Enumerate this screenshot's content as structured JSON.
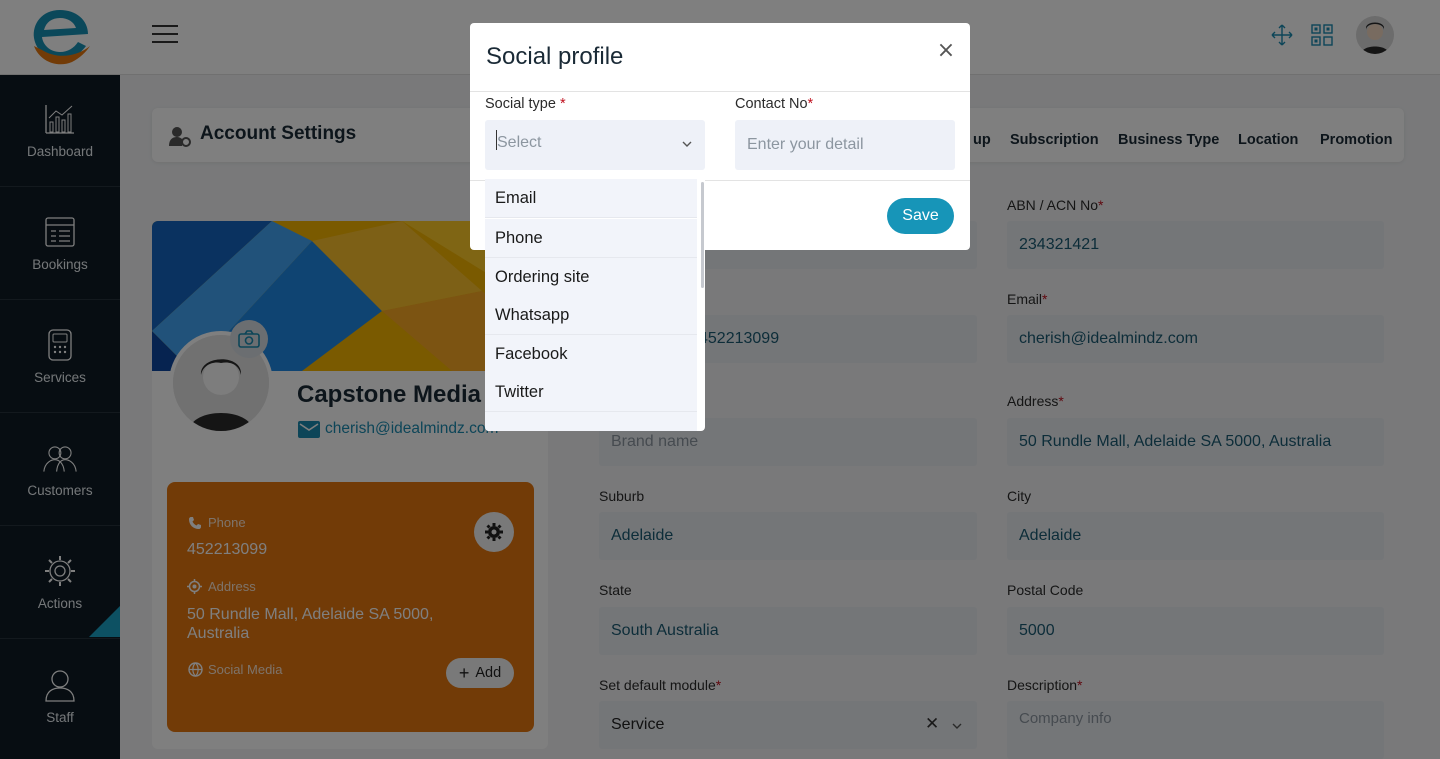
{
  "sidebar": {
    "items": [
      {
        "label": "Dashboard",
        "icon": "chart-icon"
      },
      {
        "label": "Bookings",
        "icon": "list-icon"
      },
      {
        "label": "Services",
        "icon": "calculator-icon"
      },
      {
        "label": "Customers",
        "icon": "users-icon"
      },
      {
        "label": "Actions",
        "icon": "gear-icon"
      },
      {
        "label": "Staff",
        "icon": "user-icon"
      }
    ]
  },
  "header": {
    "title": "Account Settings",
    "tabs": [
      "up",
      "Subscription",
      "Business Type",
      "Location",
      "Promotion"
    ]
  },
  "profile": {
    "company_name": "Capstone Media",
    "email": "cherish@idealmindz.com",
    "phone_label": "Phone",
    "phone": "452213099",
    "address_label": "Address",
    "address": "50 Rundle Mall, Adelaide SA 5000, Australia",
    "social_label": "Social Media",
    "add_label": "Add"
  },
  "form": {
    "abn_label": "ABN / ACN No",
    "abn_value": "234321421",
    "email_label": "Email",
    "email_value": "cherish@idealmindz.com",
    "phone_partial": "452213099",
    "brand_placeholder": "Brand name",
    "address_label": "Address",
    "address_value": "50 Rundle Mall, Adelaide SA 5000, Australia",
    "suburb_label": "Suburb",
    "suburb_value": "Adelaide",
    "city_label": "City",
    "city_value": "Adelaide",
    "state_label": "State",
    "state_value": "South Australia",
    "postal_label": "Postal Code",
    "postal_value": "5000",
    "module_label": "Set default module",
    "module_value": "Service",
    "description_label": "Description",
    "description_placeholder": "Company info",
    "required_mark": "*"
  },
  "modal": {
    "title": "Social profile",
    "close": "×",
    "social_type_label": "Social type",
    "contact_label": "Contact No",
    "select_placeholder": "Select",
    "contact_placeholder": "Enter your detail",
    "save_label": "Save",
    "options": [
      "Email",
      "Phone",
      "Ordering site",
      "Whatsapp",
      "Facebook",
      "Twitter"
    ]
  },
  "colors": {
    "sidebar_bg": "#0f1b24",
    "accent": "#1795b8",
    "card_orange": "#e5760f",
    "required": "#c0101e"
  }
}
